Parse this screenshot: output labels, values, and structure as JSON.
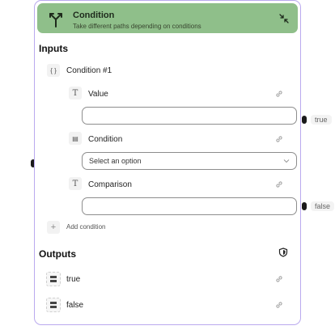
{
  "node": {
    "title": "Condition",
    "subtitle": "Take different paths depending on conditions",
    "header_icon": "split-paths-icon",
    "collapse_icon": "collapse-arrows-icon",
    "header_color": "#8fbf8a",
    "border_color": "#b9a9ee"
  },
  "inputs": {
    "title": "Inputs",
    "group": {
      "label": "Condition #1",
      "icon": "braces-icon",
      "fields": [
        {
          "label": "Value",
          "icon": "text-type-icon",
          "value": "",
          "placeholder": ""
        },
        {
          "label": "Condition",
          "icon": "list-type-icon",
          "selected": "Select an option"
        },
        {
          "label": "Comparison",
          "icon": "text-type-icon",
          "value": "",
          "placeholder": ""
        }
      ]
    },
    "add_label": "Add condition"
  },
  "outputs": {
    "title": "Outputs",
    "shield_icon": "shield-icon",
    "items": [
      {
        "label": "true",
        "icon": "output-type-icon"
      },
      {
        "label": "false",
        "icon": "output-type-icon"
      }
    ]
  },
  "ports": {
    "true_label": "true",
    "false_label": "false"
  }
}
